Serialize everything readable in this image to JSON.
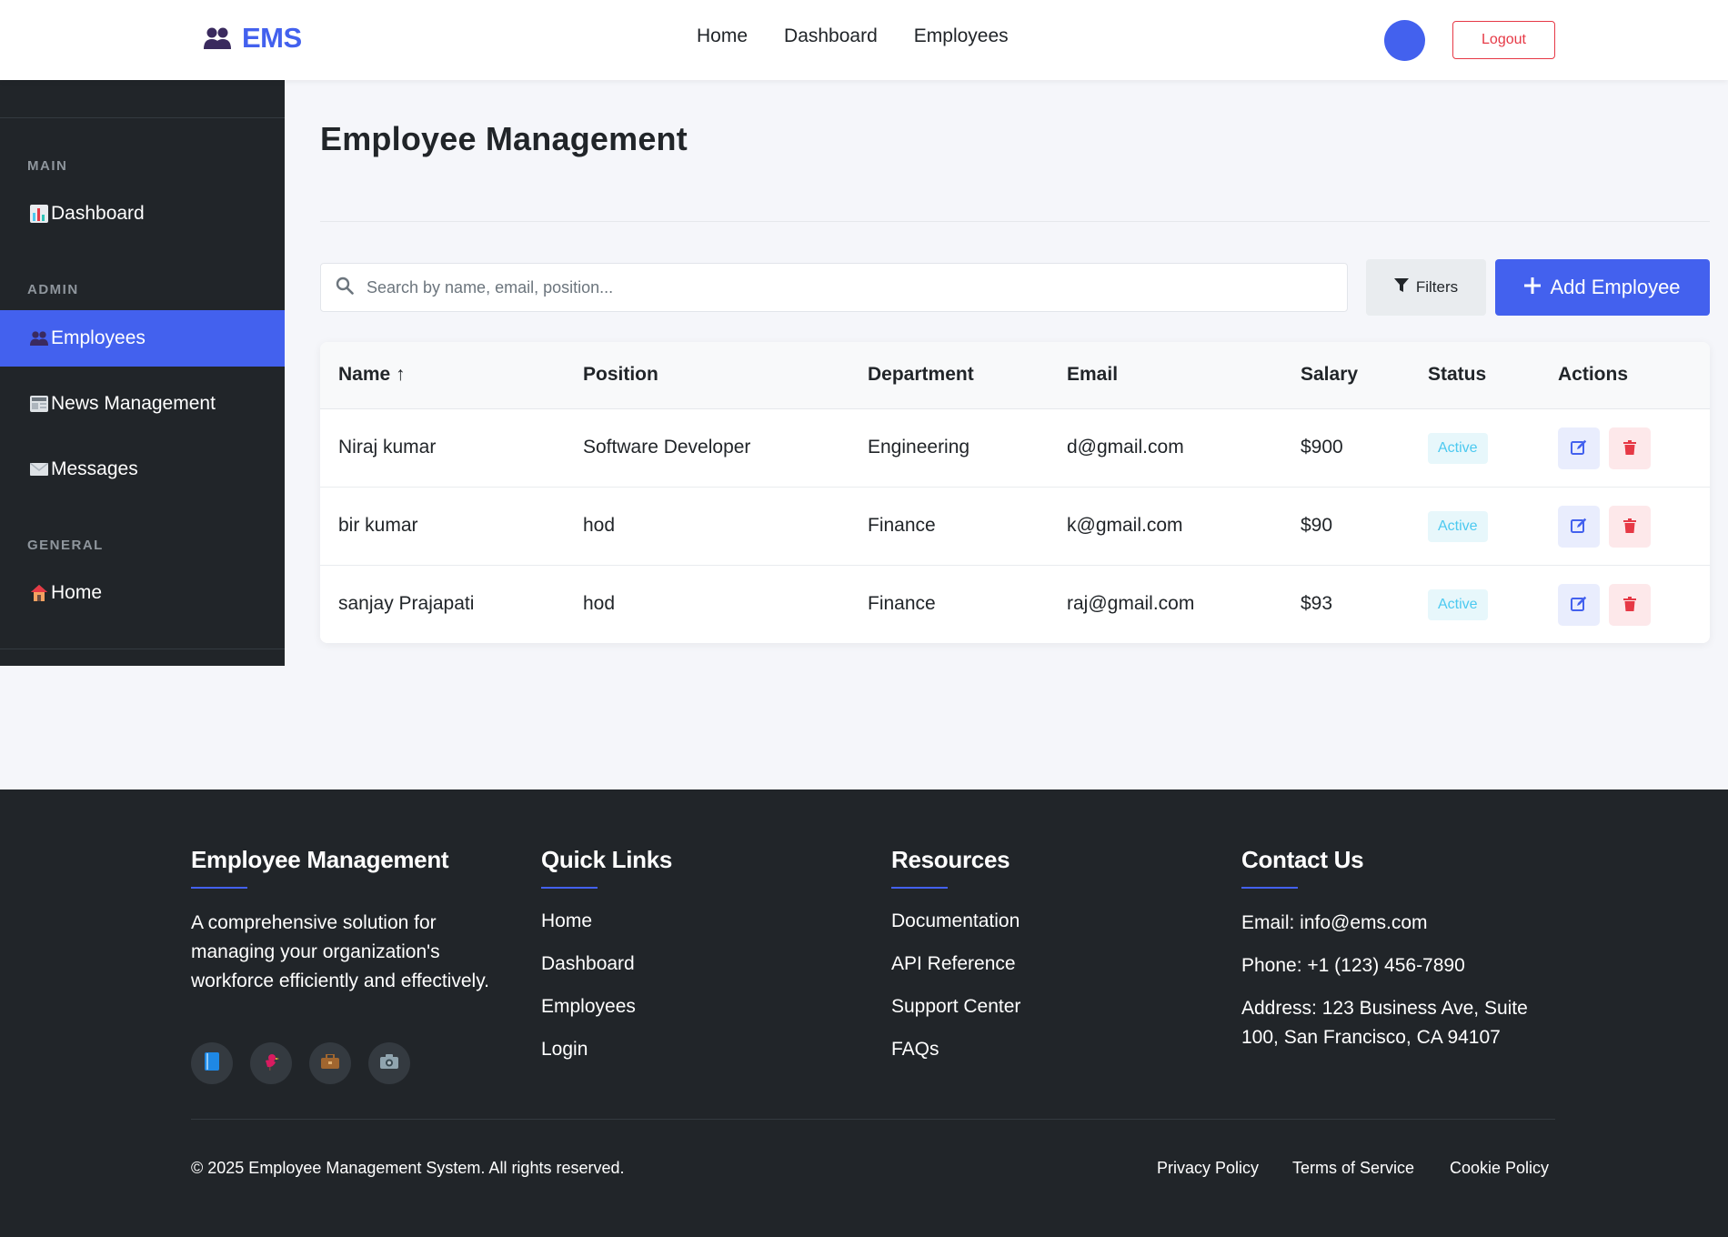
{
  "navbar": {
    "brand": "EMS",
    "links": [
      "Home",
      "Dashboard",
      "Employees"
    ],
    "logout_label": "Logout",
    "avatar_color": "#4361ee"
  },
  "sidebar": {
    "sections": [
      "MAIN",
      "ADMIN",
      "GENERAL"
    ],
    "items": [
      {
        "label": "Dashboard",
        "icon": "bar-chart-icon"
      },
      {
        "label": "Employees",
        "icon": "people-icon",
        "active": true
      },
      {
        "label": "News Management",
        "icon": "newspaper-icon"
      },
      {
        "label": "Messages",
        "icon": "envelope-icon"
      },
      {
        "label": "Home",
        "icon": "house-icon"
      }
    ]
  },
  "main": {
    "title": "Employee Management",
    "search_placeholder": "Search by name, email, position...",
    "filters_label": "Filters",
    "add_label": "Add Employee"
  },
  "table": {
    "headers": [
      "Name ↑",
      "Position",
      "Department",
      "Email",
      "Salary",
      "Status",
      "Actions"
    ],
    "rows": [
      {
        "name": "Niraj kumar",
        "position": "Software Developer",
        "department": "Engineering",
        "email": "d@gmail.com",
        "salary": "$900",
        "status": "Active"
      },
      {
        "name": "bir kumar",
        "position": "hod",
        "department": "Finance",
        "email": "k@gmail.com",
        "salary": "$90",
        "status": "Active"
      },
      {
        "name": "sanjay Prajapati",
        "position": "hod",
        "department": "Finance",
        "email": "raj@gmail.com",
        "salary": "$93",
        "status": "Active"
      }
    ]
  },
  "footer": {
    "about": {
      "heading": "Employee Management",
      "text": "A comprehensive solution for managing your organization's workforce efficiently and effectively."
    },
    "quick_links": {
      "heading": "Quick Links",
      "links": [
        "Home",
        "Dashboard",
        "Employees",
        "Login"
      ]
    },
    "resources": {
      "heading": "Resources",
      "links": [
        "Documentation",
        "API Reference",
        "Support Center",
        "FAQs"
      ]
    },
    "contact": {
      "heading": "Contact Us",
      "email": "Email: info@ems.com",
      "phone": "Phone: +1 (123) 456-7890",
      "address": "Address: 123 Business Ave, Suite 100, San Francisco, CA 94107"
    },
    "social_icons": [
      "book-icon",
      "bird-icon",
      "briefcase-icon",
      "camera-icon"
    ],
    "copyright": "© 2025 Employee Management System. All rights reserved.",
    "legal": [
      "Privacy Policy",
      "Terms of Service",
      "Cookie Policy"
    ]
  },
  "colors": {
    "accent": "#4361ee",
    "dark": "#212529",
    "danger": "#e63946",
    "status_active": "#4cc9f0"
  }
}
